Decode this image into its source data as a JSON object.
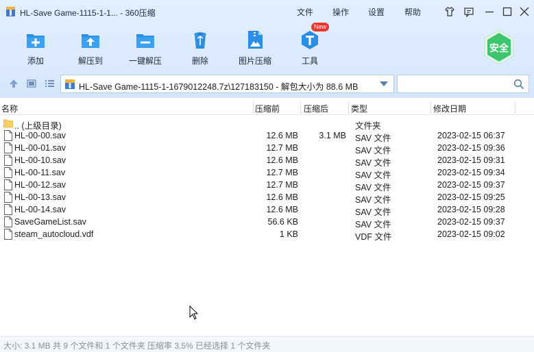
{
  "window": {
    "title": "HL-Save Game-1115-1-1... - 360压缩",
    "menu": [
      "文件",
      "操作",
      "设置",
      "帮助"
    ]
  },
  "toolbar": [
    {
      "label": "添加",
      "icon": "add-icon"
    },
    {
      "label": "解压到",
      "icon": "extract-to-icon"
    },
    {
      "label": "一键解压",
      "icon": "one-click-extract-icon"
    },
    {
      "label": "删除",
      "icon": "trash-icon"
    },
    {
      "label": "图片压缩",
      "icon": "image-compress-icon"
    },
    {
      "label": "工具",
      "icon": "tools-icon",
      "badge": "New"
    }
  ],
  "safe_badge": "安全",
  "address": {
    "path": "HL-Save Game-1115-1-1679012248.7z\\127183150 - 解包大小为 88.6 MB"
  },
  "search": {
    "placeholder": ""
  },
  "columns": {
    "name": "名称",
    "original": "压缩前",
    "compressed": "压缩后",
    "type": "类型",
    "modified": "修改日期"
  },
  "files": [
    {
      "name": ".. (上级目录)",
      "original": "",
      "compressed": "",
      "type": "文件夹",
      "date": "",
      "icon": "folder-icon"
    },
    {
      "name": "HL-00-00.sav",
      "original": "12.6 MB",
      "compressed": "3.1 MB",
      "type": "SAV 文件",
      "date": "2023-02-15 06:37",
      "icon": "file-icon"
    },
    {
      "name": "HL-00-01.sav",
      "original": "12.7 MB",
      "compressed": "",
      "type": "SAV 文件",
      "date": "2023-02-15 09:36",
      "icon": "file-icon"
    },
    {
      "name": "HL-00-10.sav",
      "original": "12.6 MB",
      "compressed": "",
      "type": "SAV 文件",
      "date": "2023-02-15 09:31",
      "icon": "file-icon"
    },
    {
      "name": "HL-00-11.sav",
      "original": "12.7 MB",
      "compressed": "",
      "type": "SAV 文件",
      "date": "2023-02-15 09:34",
      "icon": "file-icon"
    },
    {
      "name": "HL-00-12.sav",
      "original": "12.7 MB",
      "compressed": "",
      "type": "SAV 文件",
      "date": "2023-02-15 09:37",
      "icon": "file-icon"
    },
    {
      "name": "HL-00-13.sav",
      "original": "12.6 MB",
      "compressed": "",
      "type": "SAV 文件",
      "date": "2023-02-15 09:25",
      "icon": "file-icon"
    },
    {
      "name": "HL-00-14.sav",
      "original": "12.6 MB",
      "compressed": "",
      "type": "SAV 文件",
      "date": "2023-02-15 09:28",
      "icon": "file-icon"
    },
    {
      "name": "SaveGameList.sav",
      "original": "56.6 KB",
      "compressed": "",
      "type": "SAV 文件",
      "date": "2023-02-15 09:37",
      "icon": "file-icon"
    },
    {
      "name": "steam_autocloud.vdf",
      "original": "1 KB",
      "compressed": "",
      "type": "VDF 文件",
      "date": "2023-02-15 09:02",
      "icon": "file-icon"
    }
  ],
  "status": "大小: 3.1 MB 共 9 个文件和 1 个文件夹 压缩率 3.5% 已经选择 1 个文件夹",
  "colors": {
    "accent": "#2a8ee6",
    "header_bg": "#dceaff",
    "safe_green": "#39c36a"
  }
}
